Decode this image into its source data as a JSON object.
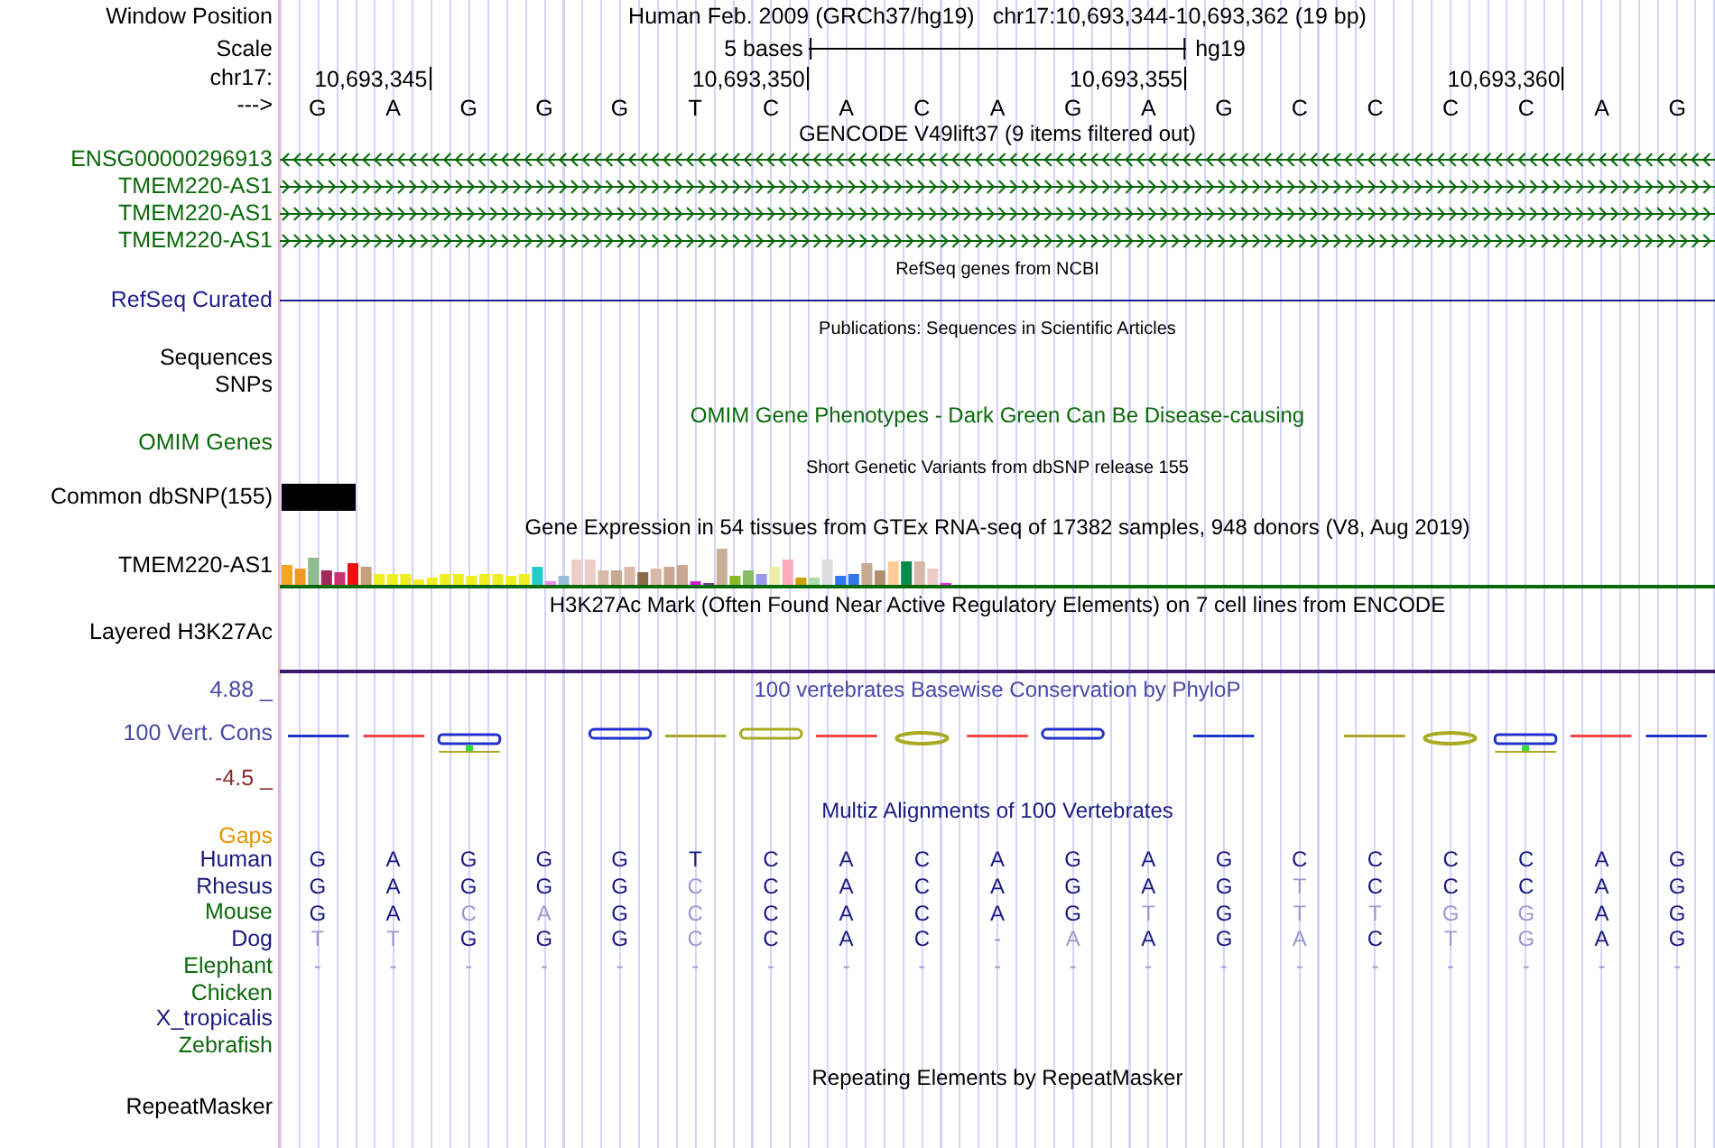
{
  "position": {
    "label": "Window Position",
    "assembly": "Human Feb. 2009 (GRCh37/hg19)",
    "range": "chr17:10,693,344-10,693,362 (19 bp)"
  },
  "scale": {
    "label": "Scale",
    "bar_label": "5 bases",
    "assembly": "hg19"
  },
  "ruler": {
    "label": "chr17:",
    "ticks": [
      "10,693,345",
      "10,693,350",
      "10,693,355",
      "10,693,360"
    ]
  },
  "sequence": {
    "label": "--->",
    "bases": [
      "G",
      "A",
      "G",
      "G",
      "G",
      "T",
      "C",
      "A",
      "C",
      "A",
      "G",
      "A",
      "G",
      "C",
      "C",
      "C",
      "C",
      "A",
      "G"
    ]
  },
  "gencode": {
    "title": "GENCODE V49lift37 (9 items filtered out)",
    "items": [
      {
        "label": "ENSG00000296913",
        "reverse": true
      },
      {
        "label": "TMEM220-AS1",
        "reverse": false
      },
      {
        "label": "TMEM220-AS1",
        "reverse": false
      },
      {
        "label": "TMEM220-AS1",
        "reverse": false
      }
    ]
  },
  "refseq": {
    "title": "RefSeq genes from NCBI",
    "label": "RefSeq Curated"
  },
  "publications": {
    "title": "Publications: Sequences in Scientific Articles",
    "label": "Sequences"
  },
  "snps": {
    "label": "SNPs"
  },
  "omim": {
    "title": "OMIM Gene Phenotypes - Dark Green Can Be Disease-causing",
    "label": "OMIM Genes"
  },
  "dbsnp": {
    "title": "Short Genetic Variants from dbSNP release 155",
    "label": "Common dbSNP(155)"
  },
  "gtex": {
    "title": "Gene Expression in 54 tissues from GTEx RNA-seq of 17382 samples, 948 donors (V8, Aug 2019)",
    "label": "TMEM220-AS1"
  },
  "h3k27ac": {
    "title": "H3K27Ac Mark (Often Found Near Active Regulatory Elements) on 7 cell lines from ENCODE",
    "label": "Layered H3K27Ac"
  },
  "conservation": {
    "title": "100 vertebrates Basewise Conservation by PhyloP",
    "label": "100 Vert. Cons",
    "max_label": "4.88 _",
    "min_label": "-4.5 _"
  },
  "multiz": {
    "title": "Multiz Alignments of 100 Vertebrates",
    "gaps_label": "Gaps",
    "species": [
      {
        "name": "Human",
        "color": "#1a1a80",
        "bases": [
          {
            "base": "G",
            "faded": false
          },
          {
            "base": "A",
            "faded": false
          },
          {
            "base": "G",
            "faded": false
          },
          {
            "base": "G",
            "faded": false
          },
          {
            "base": "G",
            "faded": false
          },
          {
            "base": "T",
            "faded": false
          },
          {
            "base": "C",
            "faded": false
          },
          {
            "base": "A",
            "faded": false
          },
          {
            "base": "C",
            "faded": false
          },
          {
            "base": "A",
            "faded": false
          },
          {
            "base": "G",
            "faded": false
          },
          {
            "base": "A",
            "faded": false
          },
          {
            "base": "G",
            "faded": false
          },
          {
            "base": "C",
            "faded": false
          },
          {
            "base": "C",
            "faded": false
          },
          {
            "base": "C",
            "faded": false
          },
          {
            "base": "C",
            "faded": false
          },
          {
            "base": "A",
            "faded": false
          },
          {
            "base": "G",
            "faded": false
          }
        ]
      },
      {
        "name": "Rhesus",
        "color": "#1a1a80",
        "bases": [
          {
            "base": "G",
            "faded": false
          },
          {
            "base": "A",
            "faded": false
          },
          {
            "base": "G",
            "faded": false
          },
          {
            "base": "G",
            "faded": false
          },
          {
            "base": "G",
            "faded": false
          },
          {
            "base": "C",
            "faded": true
          },
          {
            "base": "C",
            "faded": false
          },
          {
            "base": "A",
            "faded": false
          },
          {
            "base": "C",
            "faded": false
          },
          {
            "base": "A",
            "faded": false
          },
          {
            "base": "G",
            "faded": false
          },
          {
            "base": "A",
            "faded": false
          },
          {
            "base": "G",
            "faded": false
          },
          {
            "base": "T",
            "faded": true
          },
          {
            "base": "C",
            "faded": false
          },
          {
            "base": "C",
            "faded": false
          },
          {
            "base": "C",
            "faded": false
          },
          {
            "base": "A",
            "faded": false
          },
          {
            "base": "G",
            "faded": false
          }
        ]
      },
      {
        "name": "Mouse",
        "color": "#0a6a0a",
        "bases": [
          {
            "base": "G",
            "faded": false
          },
          {
            "base": "A",
            "faded": false
          },
          {
            "base": "C",
            "faded": true
          },
          {
            "base": "A",
            "faded": true
          },
          {
            "base": "G",
            "faded": false
          },
          {
            "base": "C",
            "faded": true
          },
          {
            "base": "C",
            "faded": false
          },
          {
            "base": "A",
            "faded": false
          },
          {
            "base": "C",
            "faded": false
          },
          {
            "base": "A",
            "faded": false
          },
          {
            "base": "G",
            "faded": false
          },
          {
            "base": "T",
            "faded": true
          },
          {
            "base": "G",
            "faded": false
          },
          {
            "base": "T",
            "faded": true
          },
          {
            "base": "T",
            "faded": true
          },
          {
            "base": "G",
            "faded": true
          },
          {
            "base": "G",
            "faded": true
          },
          {
            "base": "A",
            "faded": false
          },
          {
            "base": "G",
            "faded": false
          }
        ]
      },
      {
        "name": "Dog",
        "color": "#1a1a80",
        "bases": [
          {
            "base": "T",
            "faded": true
          },
          {
            "base": "T",
            "faded": true
          },
          {
            "base": "G",
            "faded": false
          },
          {
            "base": "G",
            "faded": false
          },
          {
            "base": "G",
            "faded": false
          },
          {
            "base": "C",
            "faded": true
          },
          {
            "base": "C",
            "faded": false
          },
          {
            "base": "A",
            "faded": false
          },
          {
            "base": "C",
            "faded": false
          },
          {
            "base": "-",
            "faded": true
          },
          {
            "base": "A",
            "faded": true
          },
          {
            "base": "A",
            "faded": false
          },
          {
            "base": "G",
            "faded": false
          },
          {
            "base": "A",
            "faded": true
          },
          {
            "base": "C",
            "faded": false
          },
          {
            "base": "T",
            "faded": true
          },
          {
            "base": "G",
            "faded": true
          },
          {
            "base": "A",
            "faded": false
          },
          {
            "base": "G",
            "faded": false
          }
        ]
      },
      {
        "name": "Elephant",
        "color": "#0a6a0a",
        "bases": [
          {
            "base": "-",
            "faded": true
          },
          {
            "base": "-",
            "faded": true
          },
          {
            "base": "-",
            "faded": true
          },
          {
            "base": "-",
            "faded": true
          },
          {
            "base": "-",
            "faded": true
          },
          {
            "base": "-",
            "faded": true
          },
          {
            "base": "-",
            "faded": true
          },
          {
            "base": "-",
            "faded": true
          },
          {
            "base": "-",
            "faded": true
          },
          {
            "base": "-",
            "faded": true
          },
          {
            "base": "-",
            "faded": true
          },
          {
            "base": "-",
            "faded": true
          },
          {
            "base": "-",
            "faded": true
          },
          {
            "base": "-",
            "faded": true
          },
          {
            "base": "-",
            "faded": true
          },
          {
            "base": "-",
            "faded": true
          },
          {
            "base": "-",
            "faded": true
          },
          {
            "base": "-",
            "faded": true
          },
          {
            "base": "-",
            "faded": true
          }
        ]
      },
      {
        "name": "Chicken",
        "color": "#0a6a0a"
      },
      {
        "name": "X_tropicalis",
        "color": "#1a1a80"
      },
      {
        "name": "Zebrafish",
        "color": "#0a6a0a"
      }
    ]
  },
  "repeatmasker": {
    "title": "Repeating Elements by RepeatMasker",
    "label": "RepeatMasker"
  }
}
